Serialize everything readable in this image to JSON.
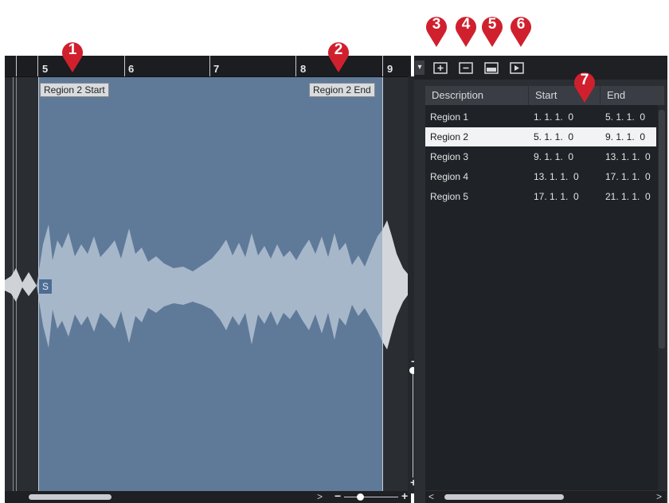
{
  "callouts": [
    "1",
    "2",
    "3",
    "4",
    "5",
    "6",
    "7"
  ],
  "ruler": {
    "bars": [
      "5",
      "6",
      "7",
      "8",
      "9"
    ]
  },
  "region_labels": {
    "start": "Region 2 Start",
    "end": "Region 2 End"
  },
  "sync_marker": "S",
  "zoom": {
    "minus": "−",
    "plus": "+"
  },
  "vzoom": {
    "minus": "−",
    "plus": "+"
  },
  "toolbar": {
    "icons": [
      "add-region-icon",
      "remove-region-icon",
      "create-event-icon",
      "play-region-icon"
    ],
    "dropdown": "▾"
  },
  "table": {
    "headers": [
      "Description",
      "Start",
      "End"
    ],
    "rows": [
      {
        "description": "Region 1",
        "start": "1. 1. 1.  0",
        "end": "5. 1. 1.  0"
      },
      {
        "description": "Region 2",
        "start": "5. 1. 1.  0",
        "end": "9. 1. 1.  0"
      },
      {
        "description": "Region 3",
        "start": "9. 1. 1.  0",
        "end": "13. 1. 1.  0"
      },
      {
        "description": "Region 4",
        "start": "13. 1. 1.  0",
        "end": "17. 1. 1.  0"
      },
      {
        "description": "Region 5",
        "start": "17. 1. 1.  0",
        "end": "21. 1. 1.  0"
      }
    ],
    "selected_index": 1
  },
  "scroll": {
    "left_arrow": "<",
    "right_arrow": ">"
  },
  "colors": {
    "callout": "#d0202e",
    "region": "#5f7a99",
    "selected_row": "#f1f3f5"
  }
}
